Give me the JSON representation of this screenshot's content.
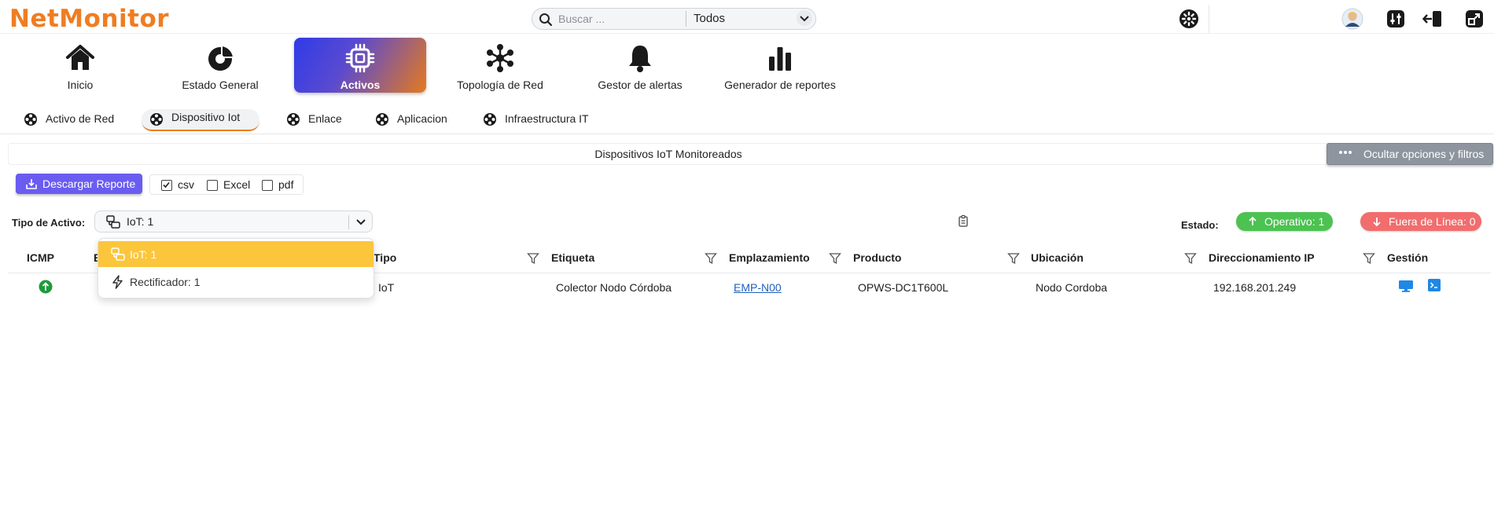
{
  "app": {
    "brand": "NetMonitor"
  },
  "search": {
    "placeholder": "Buscar ...",
    "value": "",
    "scope": "Todos"
  },
  "nav": {
    "items": [
      {
        "label": "Inicio",
        "icon": "home-icon"
      },
      {
        "label": "Estado General",
        "icon": "pie-chart-icon"
      },
      {
        "label": "Activos",
        "icon": "chip-icon",
        "active": true
      },
      {
        "label": "Topología de Red",
        "icon": "network-icon"
      },
      {
        "label": "Gestor de alertas",
        "icon": "bell-icon"
      },
      {
        "label": "Generador de reportes",
        "icon": "bar-chart-icon"
      }
    ]
  },
  "subtabs": {
    "items": [
      {
        "label": "Activo de Red"
      },
      {
        "label": "Dispositivo Iot",
        "active": true
      },
      {
        "label": "Enlace"
      },
      {
        "label": "Aplicacion"
      },
      {
        "label": "Infraestructura IT"
      }
    ]
  },
  "section": {
    "title": "Dispositivos IoT Monitoreados",
    "hide_options": "Ocultar opciones y filtros"
  },
  "report": {
    "download_label": "Descargar Reporte",
    "formats": [
      {
        "label": "csv",
        "checked": true
      },
      {
        "label": "Excel",
        "checked": false
      },
      {
        "label": "pdf",
        "checked": false
      }
    ]
  },
  "filters": {
    "tipo_label": "Tipo de Activo:",
    "tipo_selected": "IoT: 1",
    "options": [
      "IoT: 1",
      "Rectificador: 1"
    ],
    "estado_label": "Estado:",
    "operativo": "Operativo: 1",
    "fuera_linea": "Fuera de Línea: 0"
  },
  "table": {
    "columns": [
      "ICMP",
      "E",
      "Tipo",
      "Etiqueta",
      "Emplazamiento",
      "Producto",
      "Ubicación",
      "Direccionamiento IP",
      "Gestión"
    ],
    "rows": [
      {
        "icmp": "up",
        "tipo": "IoT",
        "etiqueta": "Colector Nodo Córdoba",
        "emplazamiento": "EMP-N00",
        "producto": "OPWS-DC1T600L",
        "ubicacion": "Nodo Cordoba",
        "ip": "192.168.201.249"
      }
    ]
  },
  "colors": {
    "brand": "#ef7d22",
    "download": "#6a5cf0",
    "operativo": "#4cc251",
    "fuera_linea": "#f26d6d",
    "dropdown_selected": "#fbc63c",
    "icmp_up": "#1e9a3a",
    "gestion": "#1e88e5"
  }
}
